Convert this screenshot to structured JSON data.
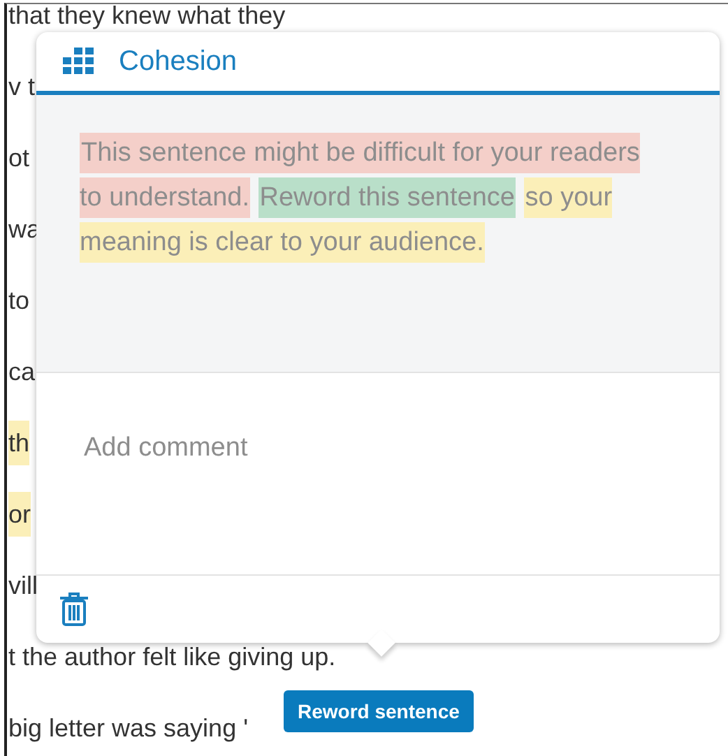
{
  "document": {
    "lines": [
      {
        "text": "that they knew what they",
        "highlighted": false
      },
      {
        "text": "v t",
        "highlighted": false
      },
      {
        "text": "ot",
        "highlighted": false
      },
      {
        "text": "wa",
        "highlighted": false
      },
      {
        "text": "to",
        "highlighted": false
      },
      {
        "text": "ca",
        "highlighted": false
      },
      {
        "text": "th",
        "highlighted": true
      },
      {
        "text": "or",
        "highlighted": true
      },
      {
        "text": "vill",
        "highlighted": false
      },
      {
        "text": "t the author felt like giving up.",
        "highlighted": false
      },
      {
        "text": "big letter was saying '",
        "highlighted": false
      }
    ]
  },
  "card": {
    "title": "Cohesion",
    "message": [
      {
        "text": "This sentence might be difficult for your readers to understand.",
        "color": "#f4cfc9"
      },
      {
        "text": "Reword this sentence",
        "color": "#b9dfc9"
      },
      {
        "text": "so your meaning is clear to your audience.",
        "color": "#fbefb8"
      }
    ],
    "comment": {
      "placeholder": "Add comment"
    }
  },
  "action_button": {
    "label": "Reword sentence"
  }
}
